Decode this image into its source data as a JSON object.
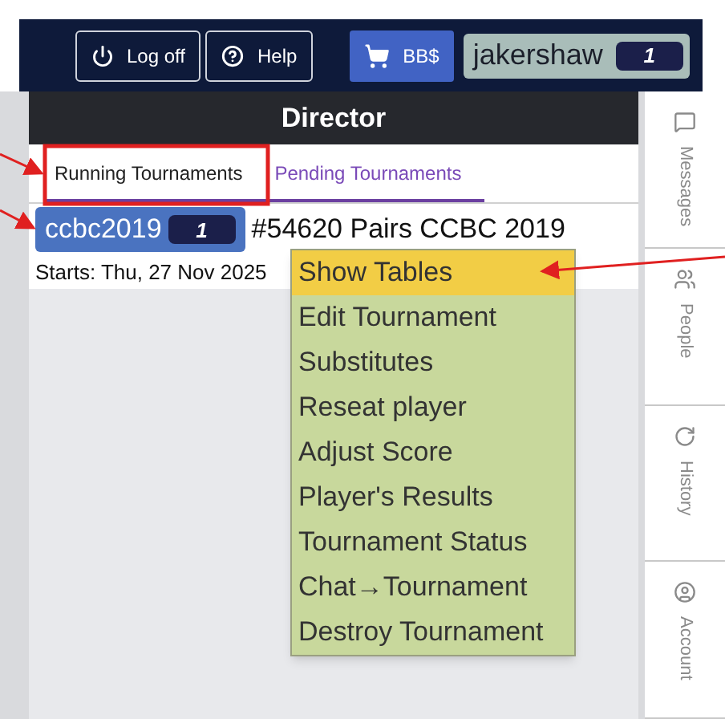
{
  "header": {
    "buttons": [
      {
        "label": "Log off",
        "kind": "power"
      },
      {
        "label": "Help",
        "kind": "help"
      }
    ],
    "store_button": {
      "label": "BB$"
    },
    "user": {
      "name": "jakershaw",
      "ticket": "1"
    }
  },
  "panel": {
    "title": "Director",
    "tabs": [
      {
        "label": "Running Tournaments",
        "selected": true
      },
      {
        "label": "Pending Tournaments",
        "selected": false
      }
    ],
    "tournament": {
      "tag": "ccbc2019",
      "ticket": "1",
      "title": "#54620 Pairs CCBC 2019",
      "starts": "Starts: Thu, 27 Nov 2025"
    }
  },
  "context_menu": [
    {
      "label": "Show Tables",
      "selected": true
    },
    {
      "label": "Edit Tournament",
      "selected": false
    },
    {
      "label": "Substitutes",
      "selected": false
    },
    {
      "label": "Reseat player",
      "selected": false
    },
    {
      "label": "Adjust Score",
      "selected": false
    },
    {
      "label": "Player's Results",
      "selected": false
    },
    {
      "label": "Tournament Status",
      "selected": false
    },
    {
      "label": "Chat→Tournament",
      "selected": false
    },
    {
      "label": "Destroy Tournament",
      "selected": false
    }
  ],
  "sidebar": [
    {
      "label": "Messages",
      "kind": "messages"
    },
    {
      "label": "People",
      "kind": "people"
    },
    {
      "label": "History",
      "kind": "history"
    },
    {
      "label": "Account",
      "kind": "account"
    }
  ]
}
